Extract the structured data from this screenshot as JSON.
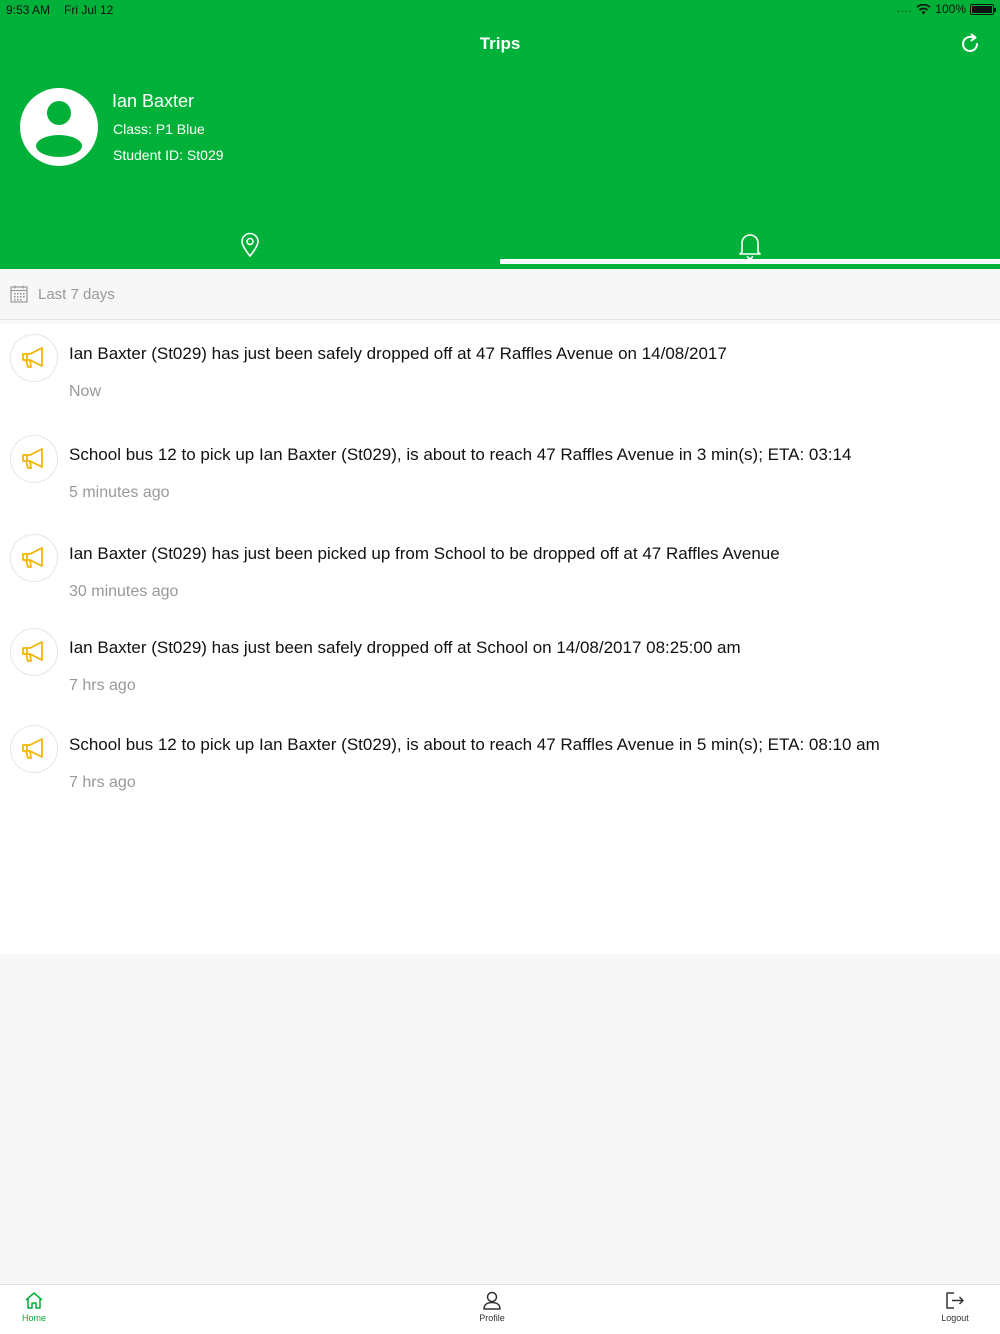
{
  "status_bar": {
    "time": "9:53 AM",
    "date": "Fri Jul 12",
    "signal": "....",
    "battery": "100%"
  },
  "header": {
    "title": "Trips",
    "refresh_icon": "refresh-icon",
    "accent_color": "#00b139"
  },
  "student": {
    "name": "Ian Baxter",
    "class": "Class: P1 Blue",
    "student_id": "Student ID: St029"
  },
  "tabs": [
    {
      "icon": "map-pin-icon",
      "selected": false
    },
    {
      "icon": "bell-icon",
      "selected": true
    }
  ],
  "filter": {
    "icon": "calendar-icon",
    "label": "Last 7 days"
  },
  "notifications": [
    {
      "icon": "megaphone-icon",
      "text": "Ian Baxter (St029) has just been safely dropped off at 47 Raffles Avenue on 14/08/2017",
      "time": "Now"
    },
    {
      "icon": "megaphone-icon",
      "text": "School bus 12 to pick up Ian Baxter (St029), is  about to reach 47 Raffles Avenue in 3 min(s);  ETA: 03:14",
      "time": "5 minutes ago"
    },
    {
      "icon": "megaphone-icon",
      "text": "Ian Baxter (St029) has just been picked up from  School to be dropped off at 47 Raffles Avenue",
      "time": "30 minutes ago"
    },
    {
      "icon": "megaphone-icon",
      "text": "Ian Baxter (St029) has just been safely dropped  off at School on 14/08/2017 08:25:00 am",
      "time": "7 hrs ago"
    },
    {
      "icon": "megaphone-icon",
      "text": "School bus 12 to pick up Ian Baxter (St029), is  about to reach 47 Raffles Avenue in 5 min(s);  ETA: 08:10 am",
      "time": "7 hrs ago"
    }
  ],
  "bottom_nav": [
    {
      "label": "Home",
      "icon": "home-icon",
      "active": true
    },
    {
      "label": "Profile",
      "icon": "user-icon",
      "active": false
    },
    {
      "label": "Logout",
      "icon": "logout-icon",
      "active": false
    }
  ]
}
